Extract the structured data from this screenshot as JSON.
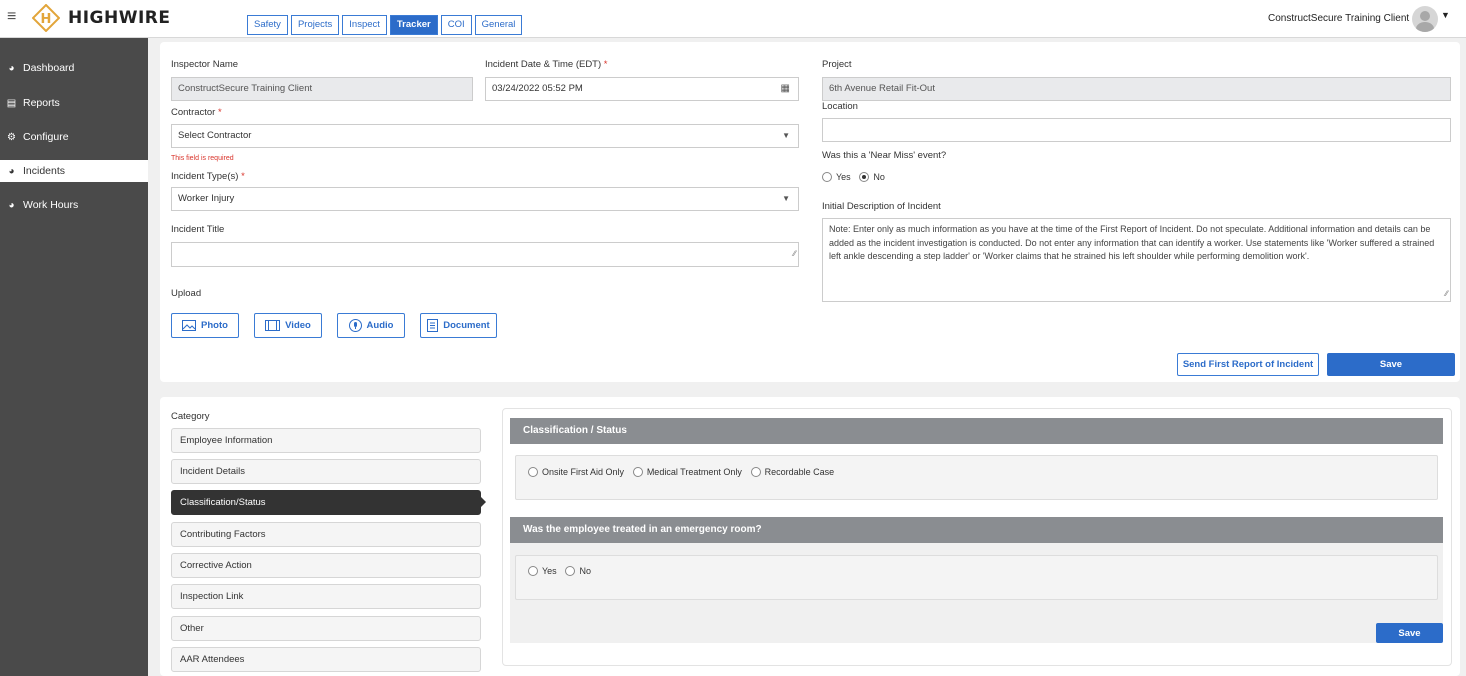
{
  "app": {
    "brand": "HIGHWIRE",
    "user": "ConstructSecure Training Client"
  },
  "tabs": [
    {
      "label": "Safety"
    },
    {
      "label": "Projects"
    },
    {
      "label": "Inspect"
    },
    {
      "label": "Tracker",
      "active": true
    },
    {
      "label": "COI"
    },
    {
      "label": "General"
    }
  ],
  "sidebar": {
    "items": [
      {
        "label": "Dashboard",
        "icon": "dashboard-icon"
      },
      {
        "label": "Reports",
        "icon": "report-icon"
      },
      {
        "label": "Configure",
        "icon": "gear-icon"
      },
      {
        "label": "Incidents",
        "icon": "dashboard-icon",
        "active": true
      },
      {
        "label": "Work Hours",
        "icon": "dashboard-icon"
      }
    ]
  },
  "form": {
    "inspector_label": "Inspector Name",
    "inspector_value": "ConstructSecure  Training Client",
    "datetime_label": "Incident Date & Time (EDT)",
    "datetime_value": "03/24/2022 05:52 PM",
    "project_label": "Project",
    "project_value": "6th Avenue Retail Fit-Out",
    "contractor_label": "Contractor",
    "contractor_value": "Select Contractor",
    "contractor_error": "This field is required",
    "location_label": "Location",
    "location_value": "",
    "near_miss_label": "Was this a 'Near Miss' event?",
    "near_miss_yes": "Yes",
    "near_miss_no": "No",
    "near_miss_selected": "No",
    "incident_type_label": "Incident Type(s)",
    "incident_type_value": "Worker Injury",
    "initial_desc_label": "Initial Description of Incident",
    "initial_desc_value": "Note: Enter only as much information as you have at the time of the First Report of Incident. Do not speculate. Additional information and details can be added as the incident investigation is conducted.  Do not enter any information that can identify a worker.  Use statements like 'Worker suffered a strained left ankle descending a step ladder' or 'Worker claims that he strained his left shoulder while performing demolition work'.",
    "title_label": "Incident Title",
    "title_value": "",
    "upload_label": "Upload",
    "upload_buttons": [
      "Photo",
      "Video",
      "Audio",
      "Document"
    ],
    "send_report_label": "Send First Report of Incident",
    "save_label": "Save"
  },
  "category": {
    "label": "Category",
    "items": [
      "Employee Information",
      "Incident Details",
      "Classification/Status",
      "Contributing Factors",
      "Corrective Action",
      "Inspection Link",
      "Other",
      "AAR Attendees"
    ],
    "active": "Classification/Status"
  },
  "classification": {
    "title": "Classification / Status",
    "options": [
      "Onsite First Aid Only",
      "Medical Treatment Only",
      "Recordable Case"
    ],
    "er_title": "Was the employee treated in an emergency room?",
    "er_options": [
      "Yes",
      "No"
    ],
    "save_label": "Save"
  },
  "colors": {
    "accent": "#2c6cc9",
    "sidebar": "#4a4a4a",
    "error": "#d9342b",
    "section_header": "#8a8d91"
  }
}
